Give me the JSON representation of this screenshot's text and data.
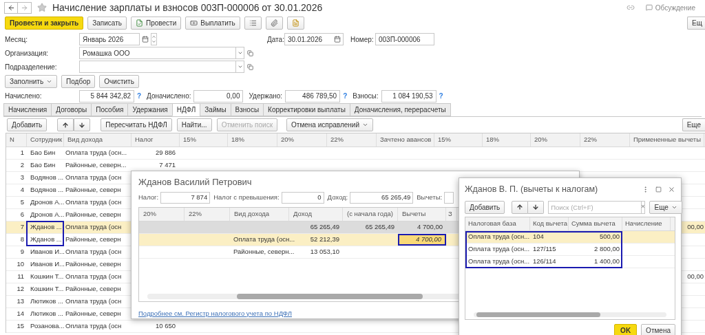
{
  "window": {
    "title": "Начисление зарплаты и взносов 003П-000006 от 30.01.2026",
    "discussion": "Обсуждение"
  },
  "toolbar": {
    "buttons": [
      {
        "label": "Провести и закрыть",
        "kind": "primary"
      },
      {
        "label": "Записать",
        "kind": "plain"
      },
      {
        "label": "Провести",
        "kind": "post"
      },
      {
        "label": "Выплатить",
        "kind": "pay"
      },
      {
        "kind": "list"
      },
      {
        "kind": "clip"
      },
      {
        "kind": "report"
      }
    ],
    "more": "Ещ"
  },
  "header": {
    "month": {
      "label": "Месяц:",
      "value": "Январь 2026"
    },
    "date": {
      "label": "Дата:",
      "value": "30.01.2026"
    },
    "number": {
      "label": "Номер:",
      "value": "003П-000006"
    },
    "organization": {
      "label": "Организация:",
      "value": "Ромашка ООО"
    },
    "department": {
      "label": "Подразделение:"
    }
  },
  "actions": [
    {
      "label": "Заполнить",
      "dropdown": true
    },
    {
      "label": "Подбор",
      "dropdown": false
    },
    {
      "label": "Очистить",
      "dropdown": false
    }
  ],
  "totals": [
    {
      "label": "Начислено:",
      "value": "5 844 342,82",
      "help": "?"
    },
    {
      "label": "Доначислено:",
      "value": "0,00"
    },
    {
      "label": "Удержано:",
      "value": "486 789,50",
      "help": "?"
    },
    {
      "label": "Взносы:",
      "value": "1 084 190,53",
      "help": "?"
    }
  ],
  "tabs": [
    {
      "label": "Начисления",
      "selected": false
    },
    {
      "label": "Договоры",
      "selected": false
    },
    {
      "label": "Пособия",
      "selected": false
    },
    {
      "label": "Удержания",
      "selected": false
    },
    {
      "label": "НДФЛ",
      "selected": true
    },
    {
      "label": "Займы",
      "selected": false
    },
    {
      "label": "Взносы",
      "selected": false
    },
    {
      "label": "Корректировки выплаты",
      "selected": false
    },
    {
      "label": "Доначисления, перерасчеты",
      "selected": false
    }
  ],
  "table_toolbar": {
    "buttons": [
      {
        "label": "Добавить",
        "kind": "button",
        "disabled": false
      },
      {
        "kind": "up",
        "disabled": false
      },
      {
        "kind": "down",
        "disabled": false
      },
      {
        "label": "Пересчитать НДФЛ",
        "kind": "button",
        "disabled": false
      },
      {
        "label": "Найти...",
        "kind": "button",
        "disabled": false
      },
      {
        "label": "Отменить поиск",
        "kind": "button",
        "disabled": true
      },
      {
        "label": "Отмена исправлений",
        "kind": "menu",
        "disabled": false
      }
    ],
    "more": "Еще"
  },
  "table": {
    "columns": [
      "N",
      "Сотрудник",
      "Вид дохода",
      "Налог",
      "15%",
      "18%",
      "20%",
      "22%",
      "Зачтено авансов",
      "15%",
      "18%",
      "20%",
      "22%",
      "Примененные вычеты"
    ],
    "rows": [
      {
        "n": "1",
        "employee": "Бао Бин",
        "income": "Оплата труда (осн...",
        "tax": "29 886",
        "selected": false
      },
      {
        "n": "2",
        "employee": "Бао Бин",
        "income": "Районные, северн...",
        "tax": "7 471",
        "selected": false
      },
      {
        "n": "3",
        "employee": "Водянов ...",
        "income": "Оплата труда (осн",
        "selected": false
      },
      {
        "n": "4",
        "employee": "Водянов ...",
        "income": "Районные, северн",
        "selected": false
      },
      {
        "n": "5",
        "employee": "Дронов А...",
        "income": "Оплата труда (осн",
        "selected": false
      },
      {
        "n": "6",
        "employee": "Дронов А...",
        "income": "Районные, северн",
        "selected": false
      },
      {
        "n": "7",
        "employee": "Жданов ...",
        "income": "Оплата труда (осн",
        "applied": "00,00",
        "selected": true
      },
      {
        "n": "8",
        "employee": "Жданов ...",
        "income": "Районные, северн",
        "selected": false
      },
      {
        "n": "9",
        "employee": "Иванов И...",
        "income": "Оплата труда (осн",
        "selected": false
      },
      {
        "n": "10",
        "employee": "Иванов И...",
        "income": "Районные, северн",
        "selected": false
      },
      {
        "n": "11",
        "employee": "Кошкин Т...",
        "income": "Оплата труда (осн",
        "applied": "00,00",
        "selected": false
      },
      {
        "n": "12",
        "employee": "Кошкин Т...",
        "income": "Районные, северн",
        "selected": false
      },
      {
        "n": "13",
        "employee": "Лютиков ...",
        "income": "Оплата труда (осн",
        "selected": false
      },
      {
        "n": "14",
        "employee": "Лютиков ...",
        "income": "Районные, северн",
        "selected": false
      },
      {
        "n": "15",
        "employee": "Розанова...",
        "income": "Оплата труда (осн",
        "tax": "10 650",
        "selected": false
      }
    ]
  },
  "tax_dialog": {
    "title": "Жданов Василий Петрович",
    "fields": [
      {
        "label": "Налог:",
        "value": "7 874"
      },
      {
        "label": "Налог с превышения:",
        "value": "0"
      },
      {
        "label": "Доход:",
        "value": "65 265,49"
      },
      {
        "label": "Вычеты:"
      }
    ],
    "columns": [
      "20%",
      "22%",
      "Вид дохода",
      "Доход",
      "(с начала года)",
      "Вычеты",
      "З"
    ],
    "rows": [
      {
        "kind": "total",
        "cells": [
          "",
          "",
          "",
          "65 265,49",
          "65 265,49",
          "4 700,00"
        ],
        "selected": false
      },
      {
        "kind": "row",
        "cells": [
          "",
          "",
          "Оплата труда (осн...",
          "52 212,39",
          "",
          "4 700,00"
        ],
        "selected": true
      },
      {
        "kind": "row",
        "cells": [
          "",
          "",
          "Районные, северн...",
          "13 053,10",
          "",
          ""
        ],
        "selected": false
      }
    ],
    "link": "Подробнее см. Регистр налогового учета по НДФЛ"
  },
  "deductions_dialog": {
    "title": "Жданов В. П. (вычеты к налогам)",
    "add": "Добавить",
    "search": {
      "placeholder": "Поиск (Ctrl+F)",
      "clear": "×"
    },
    "more": "Еще",
    "columns": [
      "Налоговая база",
      "Код вычета",
      "Сумма вычета",
      "Начисление"
    ],
    "rows": [
      {
        "base": "Оплата труда (осн...",
        "code": "104",
        "amount": "500,00",
        "selected": true
      },
      {
        "base": "Оплата труда (осн...",
        "code": "127/115",
        "amount": "2 800,00",
        "selected": false
      },
      {
        "base": "Оплата труда (осн...",
        "code": "126/114",
        "amount": "1 400,00",
        "selected": false
      }
    ],
    "ok": "OK",
    "cancel": "Отмена"
  }
}
